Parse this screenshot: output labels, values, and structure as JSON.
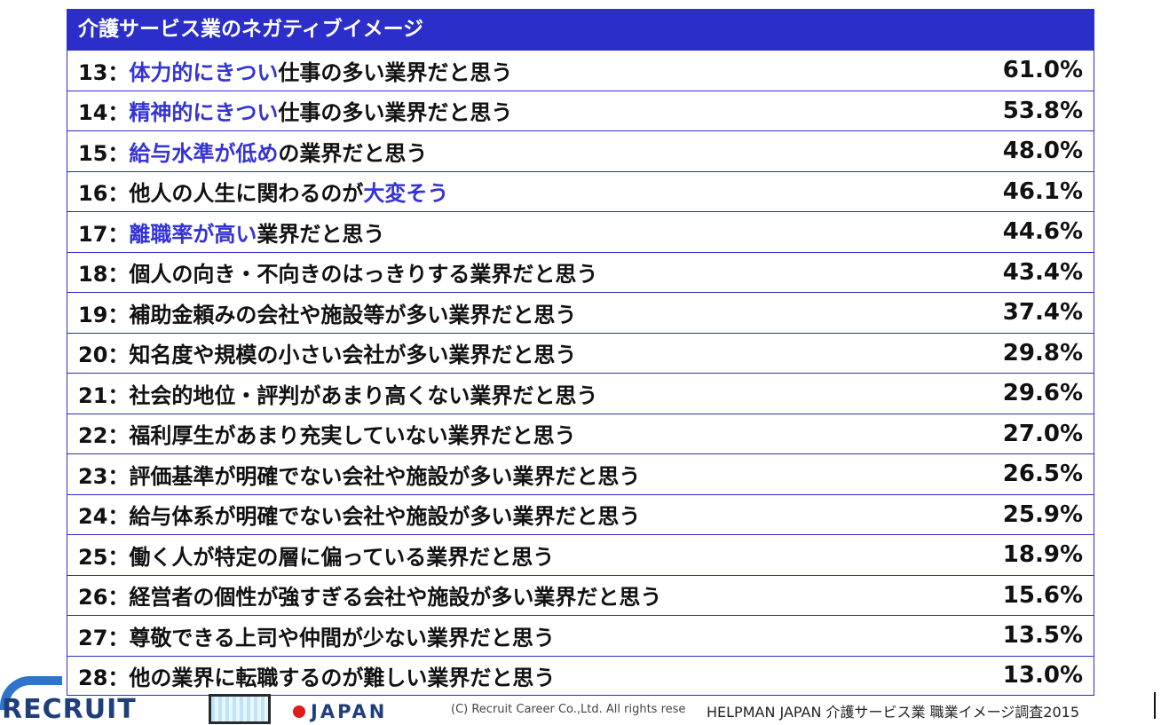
{
  "title": "介護サービス業のネガティブイメージ",
  "rows": [
    {
      "num": "13：",
      "hl_pre": "",
      "pre": "",
      "hl": "体力的にきつい",
      "post": "仕事の多い業界だと思う",
      "pct": "61.0%"
    },
    {
      "num": "14：",
      "hl_pre": "",
      "pre": "",
      "hl": "精神的にきつい",
      "post": "仕事の多い業界だと思う",
      "pct": "53.8%"
    },
    {
      "num": "15：",
      "hl_pre": "",
      "pre": "",
      "hl": "給与水準が低め",
      "post": "の業界だと思う",
      "pct": "48.0%"
    },
    {
      "num": "16：",
      "hl_pre": "",
      "pre": "他人の人生に関わるのが",
      "hl": "大変そう",
      "post": "",
      "pct": "46.1%"
    },
    {
      "num": "17：",
      "hl_pre": "",
      "pre": "",
      "hl": "離職率が高い",
      "post": "業界だと思う",
      "pct": "44.6%"
    },
    {
      "num": "18：",
      "hl_pre": "",
      "pre": "個人の向き・不向きのはっきりする業界だと思う",
      "hl": "",
      "post": "",
      "pct": "43.4%"
    },
    {
      "num": "19：",
      "hl_pre": "",
      "pre": "補助金頼みの会社や施設等が多い業界だと思う",
      "hl": "",
      "post": "",
      "pct": "37.4%"
    },
    {
      "num": "20：",
      "hl_pre": "",
      "pre": "知名度や規模の小さい会社が多い業界だと思う",
      "hl": "",
      "post": "",
      "pct": "29.8%"
    },
    {
      "num": "21：",
      "hl_pre": "",
      "pre": "社会的地位・評判があまり高くない業界だと思う",
      "hl": "",
      "post": "",
      "pct": "29.6%"
    },
    {
      "num": "22：",
      "hl_pre": "",
      "pre": "福利厚生があまり充実していない業界だと思う",
      "hl": "",
      "post": "",
      "pct": "27.0%"
    },
    {
      "num": "23：",
      "hl_pre": "",
      "pre": "評価基準が明確でない会社や施設が多い業界だと思う",
      "hl": "",
      "post": "",
      "pct": "26.5%"
    },
    {
      "num": "24：",
      "hl_pre": "",
      "pre": "給与体系が明確でない会社や施設が多い業界だと思う",
      "hl": "",
      "post": "",
      "pct": "25.9%"
    },
    {
      "num": "25：",
      "hl_pre": "",
      "pre": "働く人が特定の層に偏っている業界だと思う",
      "hl": "",
      "post": "",
      "pct": "18.9%"
    },
    {
      "num": "26：",
      "hl_pre": "",
      "pre": "経営者の個性が強すぎる会社や施設が多い業界だと思う",
      "hl": "",
      "post": "",
      "pct": "15.6%"
    },
    {
      "num": "27：",
      "hl_pre": "",
      "pre": "尊敬できる上司や仲間が少ない業界だと思う",
      "hl": "",
      "post": "",
      "pct": "13.5%"
    },
    {
      "num": "28：",
      "hl_pre": "",
      "pre": "他の業界に転職するのが難しい業界だと思う",
      "hl": "",
      "post": "",
      "pct": "13.0%"
    }
  ],
  "footer": {
    "logo_text": "RECRUIT",
    "japan": "JAPAN",
    "copyright": "(C) Recruit Career Co.,Ltd. All rights rese",
    "survey": "HELPMAN JAPAN  介護サービス業  職業イメージ調査2015"
  },
  "colors": {
    "accent": "#2b2ec8",
    "highlight": "#3434d6",
    "logo": "#2f74c8",
    "dot": "#e11a1a"
  }
}
